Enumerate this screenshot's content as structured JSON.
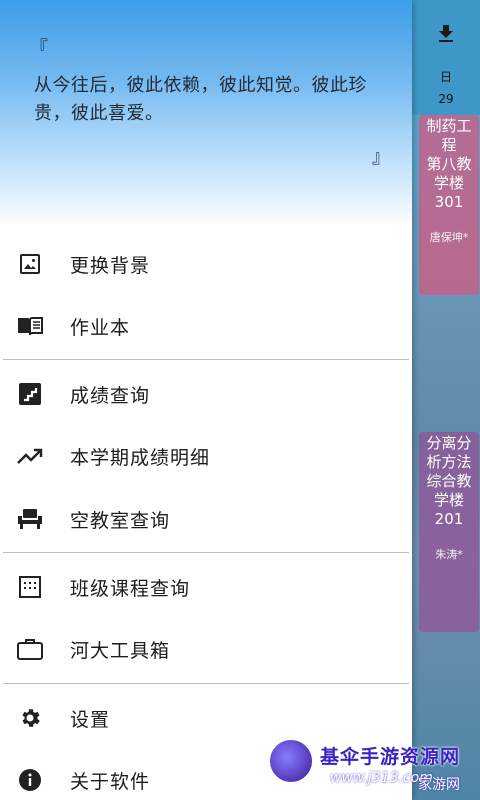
{
  "background": {
    "day_label": "日",
    "date_label": "29",
    "courses": [
      {
        "name": "制药工程第八教学楼301",
        "lines": [
          "制药工",
          "程",
          "第八教",
          "学楼",
          "301"
        ],
        "teacher": "唐保坤*"
      },
      {
        "name": "分离分析方法综合教学楼201",
        "lines": [
          "分离分",
          "析方法",
          "综合教",
          "学楼",
          "201"
        ],
        "teacher": "朱涛*"
      }
    ]
  },
  "drawer": {
    "quote_open": "『",
    "quote_text": "从今往后，彼此依赖，彼此知觉。彼此珍贵，彼此喜爱。",
    "quote_close": "』",
    "menu": [
      {
        "label": "更换背景",
        "icon": "image-icon"
      },
      {
        "label": "作业本",
        "icon": "book-icon"
      },
      {
        "label": "成绩查询",
        "icon": "stairs-icon"
      },
      {
        "label": "本学期成绩明细",
        "icon": "trending-up-icon"
      },
      {
        "label": "空教室查询",
        "icon": "chair-icon"
      },
      {
        "label": "班级课程查询",
        "icon": "calendar-grid-icon"
      },
      {
        "label": "河大工具箱",
        "icon": "briefcase-icon"
      },
      {
        "label": "设置",
        "icon": "gear-icon"
      },
      {
        "label": "关于软件",
        "icon": "info-icon"
      }
    ]
  },
  "watermark": {
    "title": "基伞手游资源网",
    "url": "www.j313.com",
    "sub": "家游网"
  }
}
